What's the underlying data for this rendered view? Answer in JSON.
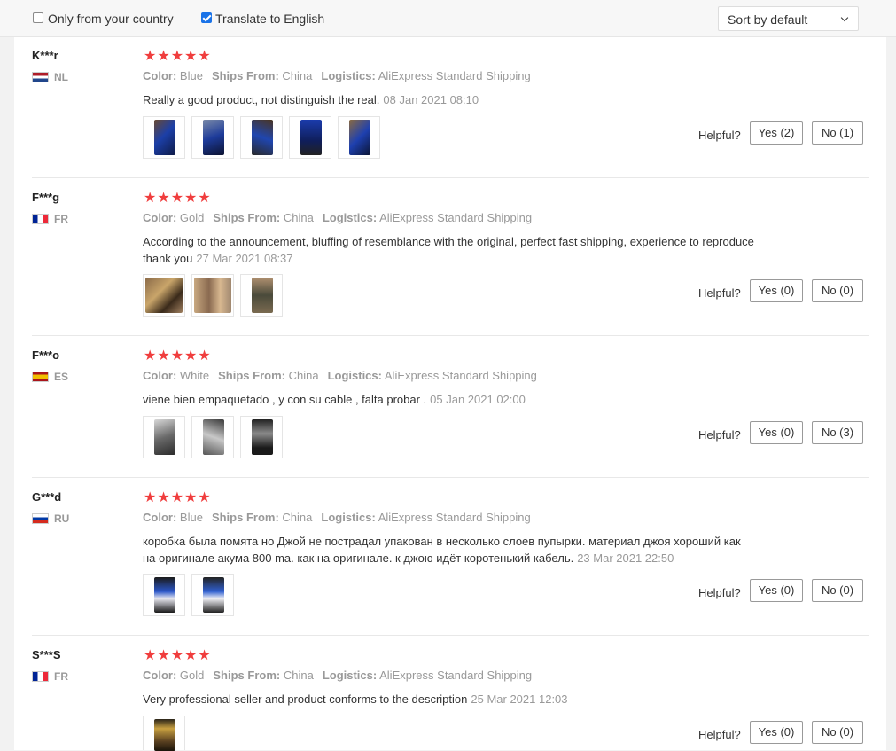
{
  "filters": {
    "only_country_label": "Only from your country",
    "only_country_checked": false,
    "translate_label": "Translate to English",
    "translate_checked": true
  },
  "sort": {
    "label": "Sort by default"
  },
  "colors": {
    "star": "#f03d3d",
    "muted": "#999999",
    "checkbox": "#1a73e8"
  },
  "helpful_label": "Helpful?",
  "reviews": [
    {
      "user": "K***r",
      "country": "NL",
      "stars": "★★★★★",
      "rating": 5,
      "color_key": "Color:",
      "color": "Blue",
      "ships_key": "Ships From:",
      "ships": "China",
      "logistics_key": "Logistics:",
      "logistics": "AliExpress Standard Shipping",
      "text": "Really a good product, not distinguish the real.",
      "date": "08 Jan 2021 08:10",
      "yes": "Yes (2)",
      "no": "No (1)"
    },
    {
      "user": "F***g",
      "country": "FR",
      "stars": "★★★★★",
      "rating": 5,
      "color_key": "Color:",
      "color": "Gold",
      "ships_key": "Ships From:",
      "ships": "China",
      "logistics_key": "Logistics:",
      "logistics": "AliExpress Standard Shipping",
      "text": "According to the announcement, bluffing of resemblance with the original, perfect fast shipping, experience to reproduce thank you",
      "date": "27 Mar 2021 08:37",
      "yes": "Yes (0)",
      "no": "No (0)"
    },
    {
      "user": "F***o",
      "country": "ES",
      "stars": "★★★★★",
      "rating": 5,
      "color_key": "Color:",
      "color": "White",
      "ships_key": "Ships From:",
      "ships": "China",
      "logistics_key": "Logistics:",
      "logistics": "AliExpress Standard Shipping",
      "text": "viene bien empaquetado , y con su cable , falta probar .",
      "date": "05 Jan 2021 02:00",
      "yes": "Yes (0)",
      "no": "No (3)"
    },
    {
      "user": "G***d",
      "country": "RU",
      "stars": "★★★★★",
      "rating": 5,
      "color_key": "Color:",
      "color": "Blue",
      "ships_key": "Ships From:",
      "ships": "China",
      "logistics_key": "Logistics:",
      "logistics": "AliExpress Standard Shipping",
      "text": "коробка была помята но Джой не пострадал упакован в несколько слоев пупырки. материал джоя хороший как на оригинале акума 800 ma. как на оригинале. к джою идёт коротенький кабель.",
      "date": "23 Mar 2021 22:50",
      "yes": "Yes (0)",
      "no": "No (0)"
    },
    {
      "user": "S***S",
      "country": "FR",
      "stars": "★★★★★",
      "rating": 5,
      "color_key": "Color:",
      "color": "Gold",
      "ships_key": "Ships From:",
      "ships": "China",
      "logistics_key": "Logistics:",
      "logistics": "AliExpress Standard Shipping",
      "text": "Very professional seller and product conforms to the description",
      "date": "25 Mar 2021 12:03",
      "yes": "Yes (0)",
      "no": "No (0)"
    }
  ]
}
